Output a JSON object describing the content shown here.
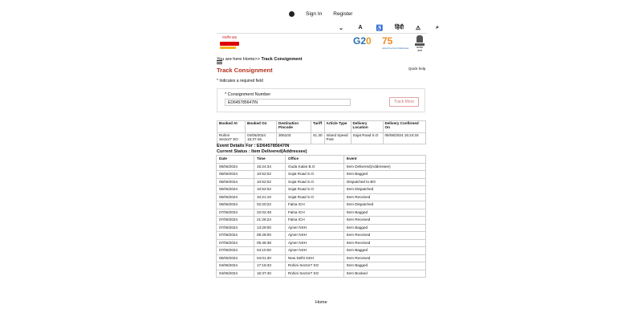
{
  "topbar": {
    "signin": "Sign In",
    "register": "Register"
  },
  "tools": {
    "dropdown": "⌄",
    "textsize": "A",
    "accessibility": "♿",
    "lang": "हिंदी",
    "sitemap": "⚠",
    "search": "⌕"
  },
  "logo": {
    "text": "भारतीय डाक"
  },
  "g20": {
    "g": "G2",
    "zero": "0"
  },
  "years": {
    "num": "75",
    "caption": "Azadi Ka Amrit Mahotsav"
  },
  "emblem": {
    "caption": "सत्यमेव जयते"
  },
  "breadcrumb": {
    "prefix": "You are here Home>>",
    "current": "Track Consignment"
  },
  "page": {
    "title": "Track Consignment",
    "quick_help": "Quick help",
    "required_note": "* Indicates a required field"
  },
  "form": {
    "label": "* Consignment Number",
    "value": "ED645785647IN",
    "button": "Track More"
  },
  "summary": {
    "headers": [
      "Booked At",
      "Booked On",
      "Destination Pincode",
      "Tariff",
      "Article Type",
      "Delivery Location",
      "Delivery Confirmed On"
    ],
    "row": [
      "Rohini Sector7 SO",
      "04/06/2024 15:37:46",
      "306103",
      "41.30",
      "Inland Speed Post",
      "Sojat Road S.O",
      "06/06/2024 15:24:34"
    ]
  },
  "event_details": {
    "line1": "Event Details For : ED645785647IN",
    "line2": "Current Status : Item Delivered(Addressee)"
  },
  "events": {
    "headers": [
      "Date",
      "Time",
      "Office",
      "Event"
    ],
    "rows": [
      [
        "06/06/2024",
        "15:24:34",
        "Guda Kalan B.O",
        "Item Delivered(Addressee)"
      ],
      [
        "06/06/2024",
        "10:52:02",
        "Sojat Road S.O",
        "Item Bagged"
      ],
      [
        "06/06/2024",
        "10:52:02",
        "Sojat Road S.O",
        "Dispatched to BO"
      ],
      [
        "06/06/2024",
        "10:52:02",
        "Sojat Road S.O",
        "Item Dispatched"
      ],
      [
        "06/06/2024",
        "10:21:10",
        "Sojat Road S.O",
        "Item Received"
      ],
      [
        "06/06/2024",
        "02:20:22",
        "Falna ICH",
        "Item Dispatched"
      ],
      [
        "07/06/2024",
        "22:02:48",
        "Falna ICH",
        "Item Bagged"
      ],
      [
        "07/06/2024",
        "21:26:24",
        "Falna ICH",
        "Item Received"
      ],
      [
        "07/06/2024",
        "13:29:00",
        "Ajmer NSH",
        "Item Bagged"
      ],
      [
        "07/06/2024",
        "08:28:00",
        "Ajmer NSH",
        "Item Received"
      ],
      [
        "07/06/2024",
        "05:46:38",
        "Ajmer NSH",
        "Item Received"
      ],
      [
        "07/06/2024",
        "04:10:00",
        "Ajmer NSH",
        "Item Bagged"
      ],
      [
        "05/06/2024",
        "04:01:30",
        "New Delhi NSH",
        "Item Received"
      ],
      [
        "04/06/2024",
        "17:16:33",
        "Rohini Sector7 SO",
        "Item Bagged"
      ],
      [
        "04/06/2024",
        "15:37:40",
        "Rohini Sector7 SO",
        "Item Booked"
      ]
    ]
  },
  "footer": {
    "home": "Home"
  }
}
